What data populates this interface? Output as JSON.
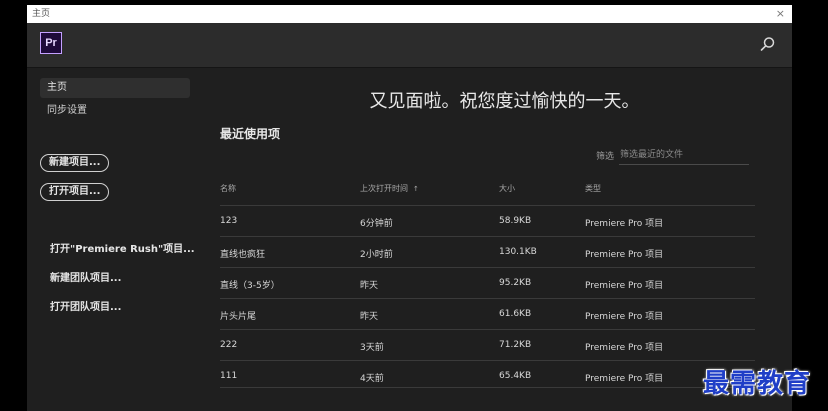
{
  "window": {
    "title": "主页",
    "close_glyph": "×"
  },
  "topbar": {
    "app_logo_text": "Pr"
  },
  "sidebar": {
    "items": [
      {
        "label": "主页"
      },
      {
        "label": "同步设置"
      }
    ],
    "new_project": "新建项目...",
    "open_project": "打开项目...",
    "links": [
      "打开\"Premiere Rush\"项目...",
      "新建团队项目...",
      "打开团队项目..."
    ]
  },
  "main": {
    "greeting": "又见面啦。祝您度过愉快的一天。",
    "recent_title": "最近使用项",
    "filter_label": "筛选",
    "filter_placeholder": "筛选最近的文件"
  },
  "table": {
    "headers": {
      "name": "名称",
      "last_opened": "上次打开时间",
      "sort_glyph": "↑",
      "size": "大小",
      "type": "类型"
    },
    "rows": [
      {
        "name": "123",
        "time": "6分钟前",
        "size": "58.9KB",
        "type": "Premiere Pro 项目"
      },
      {
        "name": "直线也疯狂",
        "time": "2小时前",
        "size": "130.1KB",
        "type": "Premiere Pro 项目"
      },
      {
        "name": "直线（3-5岁）",
        "time": "昨天",
        "size": "95.2KB",
        "type": "Premiere Pro 项目"
      },
      {
        "name": "片头片尾",
        "time": "昨天",
        "size": "61.6KB",
        "type": "Premiere Pro 项目"
      },
      {
        "name": "222",
        "time": "3天前",
        "size": "71.2KB",
        "type": "Premiere Pro 项目"
      },
      {
        "name": "111",
        "time": "4天前",
        "size": "65.4KB",
        "type": "Premiere Pro 项目"
      }
    ]
  },
  "watermark": {
    "text": "最需教育"
  },
  "colors": {
    "accent_logo": "#c4a0ff",
    "background": "#1f1f1f",
    "watermark": "#1f3ec7"
  }
}
